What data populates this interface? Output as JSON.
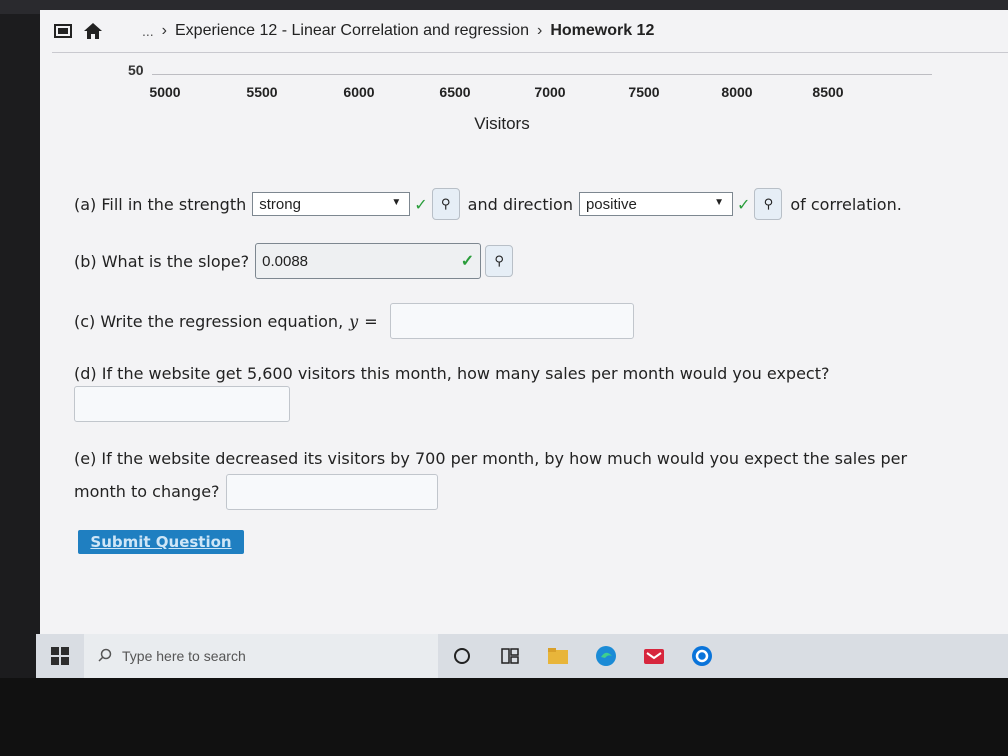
{
  "breadcrumb": {
    "ellipsis": "...",
    "items": [
      "Experience 12 - Linear Correlation and regression",
      "Homework 12"
    ]
  },
  "chart_data": {
    "type": "scatter",
    "xlabel": "Visitors",
    "x_ticks": [
      "5000",
      "5500",
      "6000",
      "6500",
      "7000",
      "7500",
      "8000",
      "8500"
    ],
    "y_ticks": [
      "50"
    ]
  },
  "questions": {
    "a": {
      "prefix": "(a) Fill in the strength",
      "strength_value": "strong",
      "middle": "and direction",
      "direction_value": "positive",
      "suffix": "of correlation."
    },
    "b": {
      "prefix": "(b) What is the slope?",
      "value": "0.0088"
    },
    "c": {
      "prefix": "(c) Write the regression equation,",
      "var": "y",
      "eq": "="
    },
    "d": {
      "text": "(d) If the website get 5,600 visitors this month, how many sales per month would you expect?"
    },
    "e": {
      "line1": "(e) If the website decreased its visitors by 700 per month, by how much would you expect the sales per",
      "line2": "month to change?"
    }
  },
  "submit_label": "Submit Question",
  "taskbar": {
    "search_placeholder": "Type here to search"
  },
  "colors": {
    "accent": "#1f7fc1",
    "check": "#2a9d3b"
  }
}
